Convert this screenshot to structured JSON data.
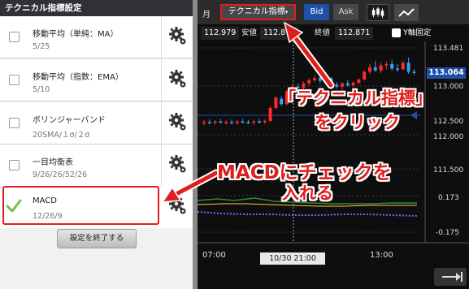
{
  "left_panel": {
    "title": "テクニカル指標設定",
    "indicators": [
      {
        "name": "移動平均（単純：MA）",
        "params": "5/25",
        "checked": false
      },
      {
        "name": "移動平均（指数：EMA）",
        "params": "5/10",
        "checked": false
      },
      {
        "name": "ボリンジャーバンド",
        "params": "20SMA/１σ/２σ",
        "checked": false
      },
      {
        "name": "一目均衡表",
        "params": "9/26/26/52/26",
        "checked": false
      },
      {
        "name": "MACD",
        "params": "12/26/9",
        "checked": true
      }
    ],
    "end_button": "設定を終了する"
  },
  "toolbar": {
    "period": "月",
    "technical": "テクニカル指標",
    "bid": "Bid",
    "ask": "Ask"
  },
  "ohlc": {
    "value1": "112.979",
    "low_label": "安値",
    "low_value": "112.871",
    "close_label": "終値",
    "close_value": "112.871",
    "y_fixed_label": "Y軸固定"
  },
  "chart": {
    "price_axis": [
      "113.481",
      "113.000",
      "112.500",
      "112.000",
      "111.500"
    ],
    "current_price": "113.064",
    "macd_axis": [
      "0.173",
      "-0.175"
    ],
    "time_axis": [
      "07:00",
      "13:00"
    ],
    "crosshair_time": "10/30 21:00"
  },
  "chart_data": {
    "type": "candlestick",
    "candles": [
      {
        "o": 112.28,
        "h": 112.33,
        "l": 112.25,
        "c": 112.3
      },
      {
        "o": 112.3,
        "h": 112.34,
        "l": 112.27,
        "c": 112.29
      },
      {
        "o": 112.29,
        "h": 112.33,
        "l": 112.26,
        "c": 112.31
      },
      {
        "o": 112.31,
        "h": 112.35,
        "l": 112.28,
        "c": 112.29
      },
      {
        "o": 112.28,
        "h": 112.33,
        "l": 112.26,
        "c": 112.3
      },
      {
        "o": 112.3,
        "h": 112.34,
        "l": 112.27,
        "c": 112.29
      },
      {
        "o": 112.29,
        "h": 112.33,
        "l": 112.26,
        "c": 112.31
      },
      {
        "o": 112.31,
        "h": 112.35,
        "l": 112.28,
        "c": 112.3
      },
      {
        "o": 112.3,
        "h": 112.33,
        "l": 112.27,
        "c": 112.29
      },
      {
        "o": 112.29,
        "h": 112.34,
        "l": 112.26,
        "c": 112.31
      },
      {
        "o": 112.31,
        "h": 112.35,
        "l": 112.28,
        "c": 112.3
      },
      {
        "o": 112.3,
        "h": 112.34,
        "l": 112.27,
        "c": 112.32
      },
      {
        "o": 112.32,
        "h": 112.55,
        "l": 112.3,
        "c": 112.52
      },
      {
        "o": 112.52,
        "h": 112.7,
        "l": 112.5,
        "c": 112.68
      },
      {
        "o": 112.66,
        "h": 112.7,
        "l": 112.55,
        "c": 112.58
      },
      {
        "o": 112.58,
        "h": 112.8,
        "l": 112.56,
        "c": 112.78
      },
      {
        "o": 112.78,
        "h": 112.88,
        "l": 112.74,
        "c": 112.85
      },
      {
        "o": 112.85,
        "h": 112.9,
        "l": 112.8,
        "c": 112.83
      },
      {
        "o": 112.83,
        "h": 112.93,
        "l": 112.8,
        "c": 112.9
      },
      {
        "o": 112.9,
        "h": 112.98,
        "l": 112.86,
        "c": 112.95
      },
      {
        "o": 112.95,
        "h": 113.02,
        "l": 112.92,
        "c": 112.98
      },
      {
        "o": 112.98,
        "h": 113.05,
        "l": 112.9,
        "c": 112.94
      },
      {
        "o": 112.94,
        "h": 113.02,
        "l": 112.92,
        "c": 113.0
      },
      {
        "o": 112.98,
        "h": 113.0,
        "l": 112.86,
        "c": 112.88
      },
      {
        "o": 112.88,
        "h": 112.92,
        "l": 112.82,
        "c": 112.85
      },
      {
        "o": 112.85,
        "h": 112.92,
        "l": 112.8,
        "c": 112.9
      },
      {
        "o": 112.9,
        "h": 112.95,
        "l": 112.85,
        "c": 112.87
      },
      {
        "o": 112.87,
        "h": 112.93,
        "l": 112.84,
        "c": 112.91
      },
      {
        "o": 112.91,
        "h": 112.98,
        "l": 112.88,
        "c": 112.96
      },
      {
        "o": 112.96,
        "h": 113.1,
        "l": 112.94,
        "c": 113.08
      },
      {
        "o": 113.08,
        "h": 113.2,
        "l": 113.05,
        "c": 113.15
      },
      {
        "o": 113.15,
        "h": 113.25,
        "l": 113.08,
        "c": 113.1
      },
      {
        "o": 113.1,
        "h": 113.22,
        "l": 113.06,
        "c": 113.18
      },
      {
        "o": 113.18,
        "h": 113.24,
        "l": 113.12,
        "c": 113.2
      },
      {
        "o": 113.2,
        "h": 113.26,
        "l": 113.1,
        "c": 113.13
      },
      {
        "o": 113.13,
        "h": 113.2,
        "l": 113.08,
        "c": 113.12
      },
      {
        "o": 113.12,
        "h": 113.25,
        "l": 113.1,
        "c": 113.22
      },
      {
        "o": 113.22,
        "h": 113.3,
        "l": 113.05,
        "c": 113.08
      },
      {
        "o": 113.08,
        "h": 113.12,
        "l": 113.03,
        "c": 113.064
      }
    ],
    "ylim": [
      111.35,
      113.55
    ]
  },
  "annotations": {
    "callout1_line1": "「テクニカル指標」",
    "callout1_line2": "をクリック",
    "callout2_line1": "MACDにチェックを",
    "callout2_line2": "入れる"
  },
  "colors": {
    "up": "#ff2a2a",
    "down": "#3aa0ff",
    "highlight": "#e11d1d",
    "accent": "#1f4fa6"
  }
}
